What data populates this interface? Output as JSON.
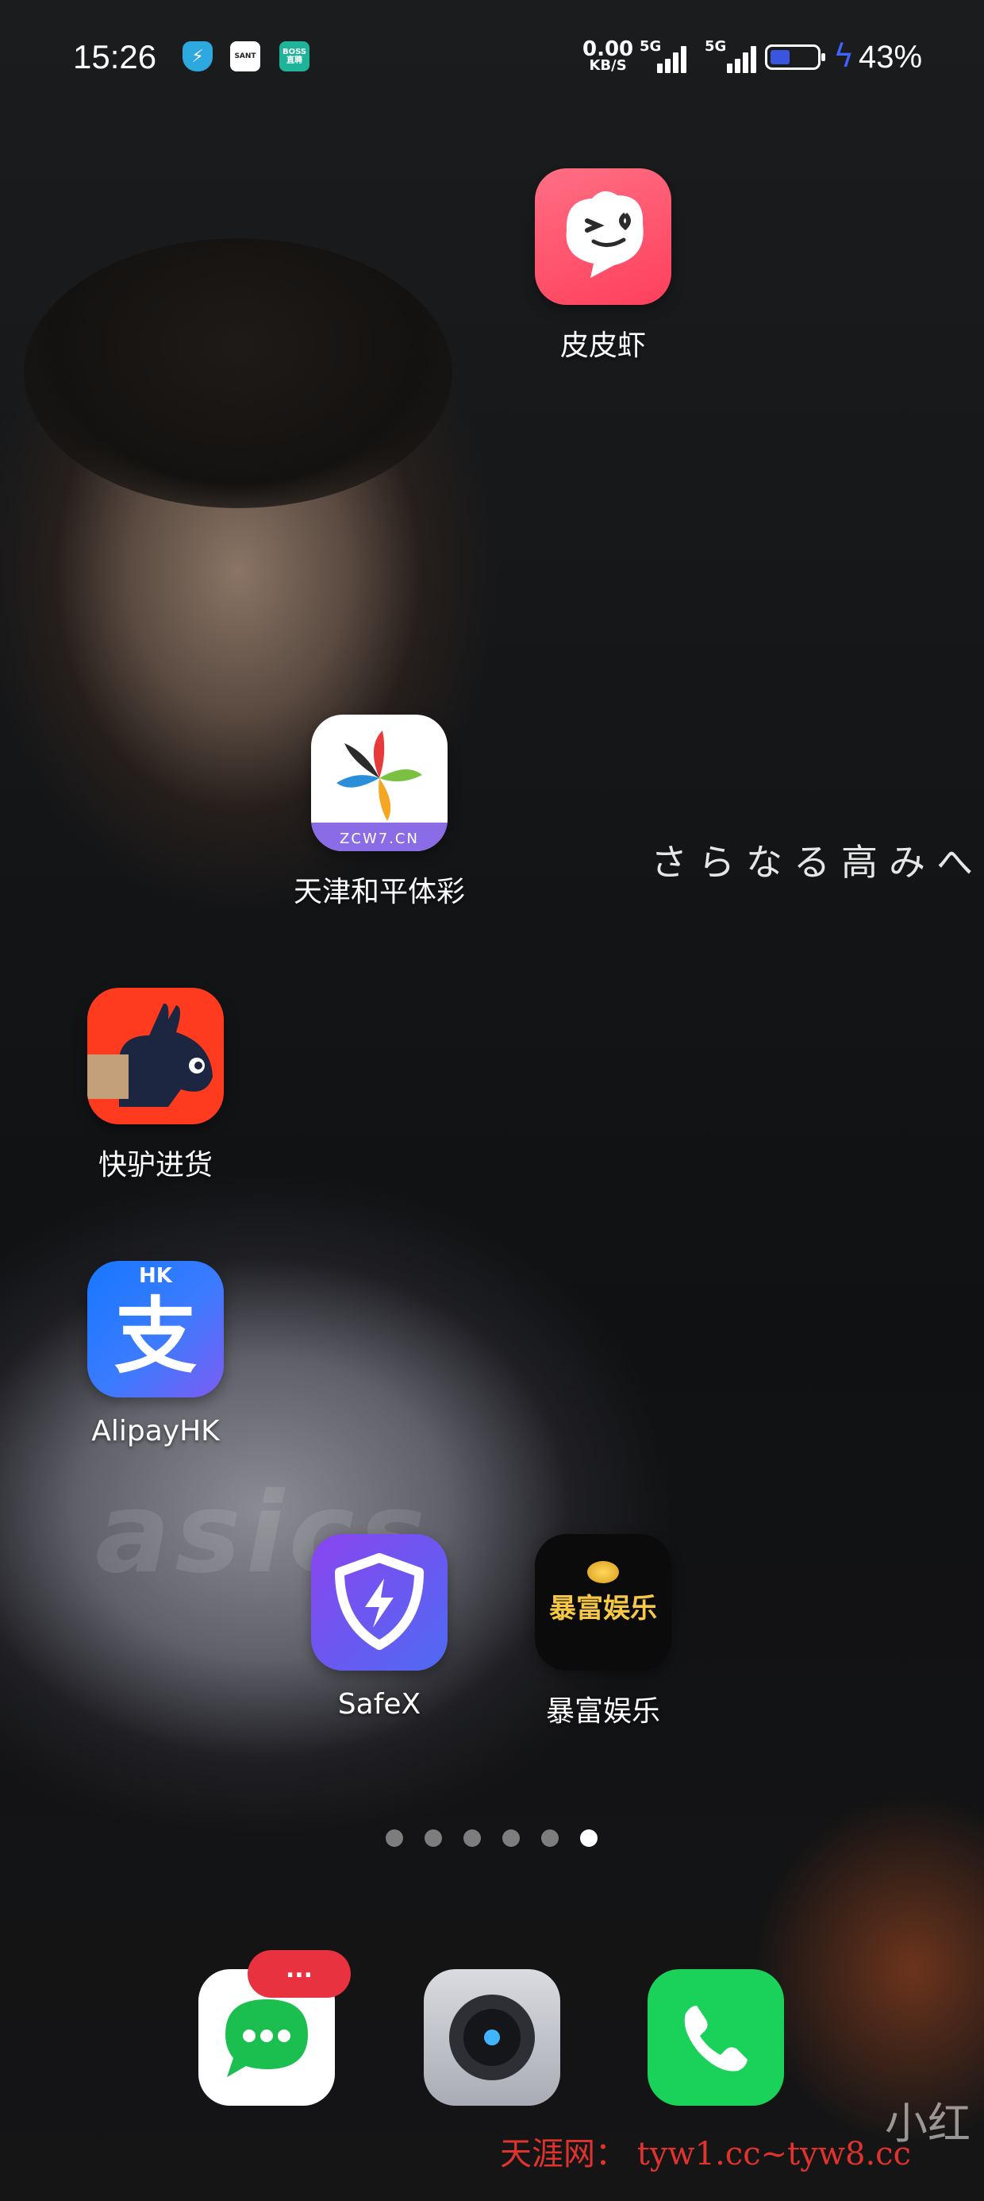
{
  "status_bar": {
    "time": "15:26",
    "notif_icons": [
      {
        "name": "shield-bolt-icon",
        "text": "⚡",
        "bg": "#2ea9e0"
      },
      {
        "name": "sant-app-icon",
        "text": "SANT",
        "bg": "#ffffff"
      },
      {
        "name": "boss-zhipin-icon",
        "text": "BOSS\n直聘",
        "bg": "#1fb39a"
      }
    ],
    "net_speed_value": "0.00",
    "net_speed_unit": "KB/S",
    "signal_1_label": "5G",
    "signal_2_label": "5G",
    "battery_percent": "43%",
    "battery_level": 0.43
  },
  "wallpaper": {
    "overlay_text": "さらなる高みへ",
    "shirt_logo": "asics"
  },
  "apps": [
    {
      "name": "皮皮虾",
      "id": "pipixia",
      "bg": "#ff4f6a"
    },
    {
      "name": "天津和平体彩",
      "id": "tianjin-heping-ticai",
      "bg": "#ffffff",
      "sub": "ZCW7.CN"
    },
    {
      "name": "快驴进货",
      "id": "kuailv-jinhuo",
      "bg": "#ff3b1f"
    },
    {
      "name": "AlipayHK",
      "id": "alipayhk",
      "bg": "#1677ff",
      "badge_text": "HK",
      "glyph": "支"
    },
    {
      "name": "SafeX",
      "id": "safex",
      "bg": "#7a4df0"
    },
    {
      "name": "暴富娱乐",
      "id": "baofu-yule",
      "bg": "#0b0b0b",
      "glyph": "暴富娱乐"
    }
  ],
  "page_indicator": {
    "count": 6,
    "active": 5
  },
  "dock": {
    "messages_badge": "...",
    "apps": [
      {
        "id": "messages",
        "label": "Messages"
      },
      {
        "id": "camera",
        "label": "Camera"
      },
      {
        "id": "phone",
        "label": "Phone"
      }
    ]
  },
  "watermarks": {
    "corner": "小红",
    "bottom": "天涯网： tyw1.cc~tyw8.cc"
  },
  "colors": {
    "accent_bolt": "#3f64ff",
    "battery_fill": "#3a55e0",
    "badge": "#e8323f"
  }
}
